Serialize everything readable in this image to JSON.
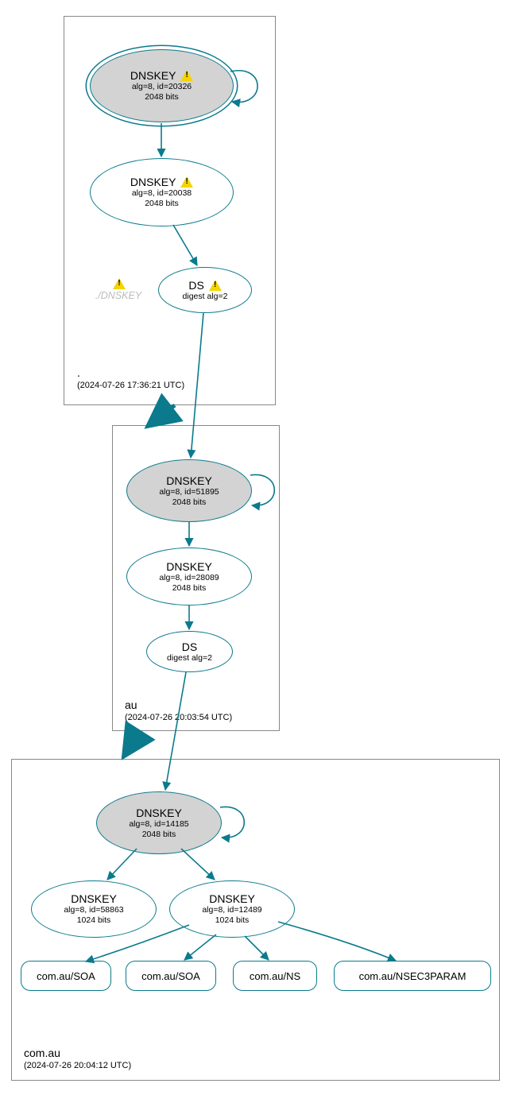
{
  "zones": {
    "root": {
      "name": ".",
      "timestamp": "(2024-07-26 17:36:21 UTC)",
      "dnskey1": {
        "title": "DNSKEY",
        "l1": "alg=8, id=20326",
        "l2": "2048 bits"
      },
      "dnskey2": {
        "title": "DNSKEY",
        "l1": "alg=8, id=20038",
        "l2": "2048 bits"
      },
      "ds": {
        "title": "DS",
        "l1": "digest alg=2"
      },
      "ghost": "./DNSKEY"
    },
    "au": {
      "name": "au",
      "timestamp": "(2024-07-26 20:03:54 UTC)",
      "dnskey1": {
        "title": "DNSKEY",
        "l1": "alg=8, id=51895",
        "l2": "2048 bits"
      },
      "dnskey2": {
        "title": "DNSKEY",
        "l1": "alg=8, id=28089",
        "l2": "2048 bits"
      },
      "ds": {
        "title": "DS",
        "l1": "digest alg=2"
      }
    },
    "comau": {
      "name": "com.au",
      "timestamp": "(2024-07-26 20:04:12 UTC)",
      "dnskey1": {
        "title": "DNSKEY",
        "l1": "alg=8, id=14185",
        "l2": "2048 bits"
      },
      "dnskey2": {
        "title": "DNSKEY",
        "l1": "alg=8, id=58863",
        "l2": "1024 bits"
      },
      "dnskey3": {
        "title": "DNSKEY",
        "l1": "alg=8, id=12489",
        "l2": "1024 bits"
      },
      "rr1": "com.au/SOA",
      "rr2": "com.au/SOA",
      "rr3": "com.au/NS",
      "rr4": "com.au/NSEC3PARAM"
    }
  }
}
